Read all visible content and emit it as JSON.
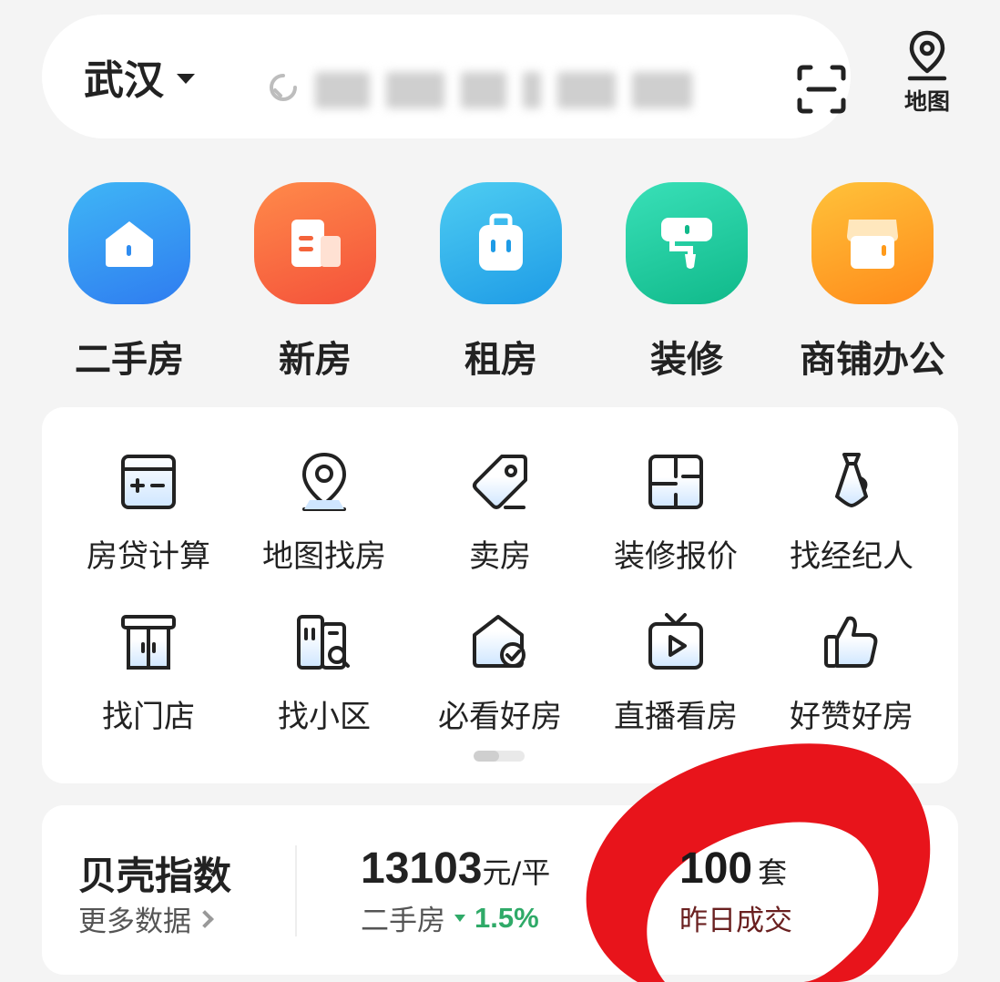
{
  "header": {
    "city": "武汉",
    "map_label": "地图"
  },
  "main_categories": [
    {
      "label": "二手房",
      "icon": "house-icon",
      "color_top": "#3fb6f6",
      "color_bottom": "#2f7cf0"
    },
    {
      "label": "新房",
      "icon": "building-doc-icon",
      "color_top": "#ff8a4a",
      "color_bottom": "#f4513a"
    },
    {
      "label": "租房",
      "icon": "suitcase-icon",
      "color_top": "#4ecdf2",
      "color_bottom": "#1e9be6"
    },
    {
      "label": "装修",
      "icon": "paint-roller-icon",
      "color_top": "#39e0b8",
      "color_bottom": "#10b98a"
    },
    {
      "label": "商铺办公",
      "icon": "storefront-icon",
      "color_top": "#ffc23a",
      "color_bottom": "#ff8a1a"
    }
  ],
  "tools": [
    {
      "label": "房贷计算",
      "icon": "calculator-icon"
    },
    {
      "label": "地图找房",
      "icon": "map-pin-icon"
    },
    {
      "label": "卖房",
      "icon": "price-tag-icon"
    },
    {
      "label": "装修报价",
      "icon": "floor-plan-icon"
    },
    {
      "label": "找经纪人",
      "icon": "necktie-icon"
    },
    {
      "label": "找门店",
      "icon": "store-door-icon"
    },
    {
      "label": "找小区",
      "icon": "community-search-icon"
    },
    {
      "label": "必看好房",
      "icon": "house-check-icon"
    },
    {
      "label": "直播看房",
      "icon": "live-tv-icon"
    },
    {
      "label": "好赞好房",
      "icon": "thumbs-up-icon"
    }
  ],
  "index": {
    "title": "贝壳指数",
    "more": "更多数据",
    "price_value": "13103",
    "price_unit": "元/平",
    "price_label": "二手房",
    "price_change": "1.5%",
    "deal_value": "100",
    "deal_unit": "套",
    "deal_label": "昨日成交"
  },
  "colors": {
    "accent_green": "#2faa68",
    "marker_red": "#e8141b"
  }
}
